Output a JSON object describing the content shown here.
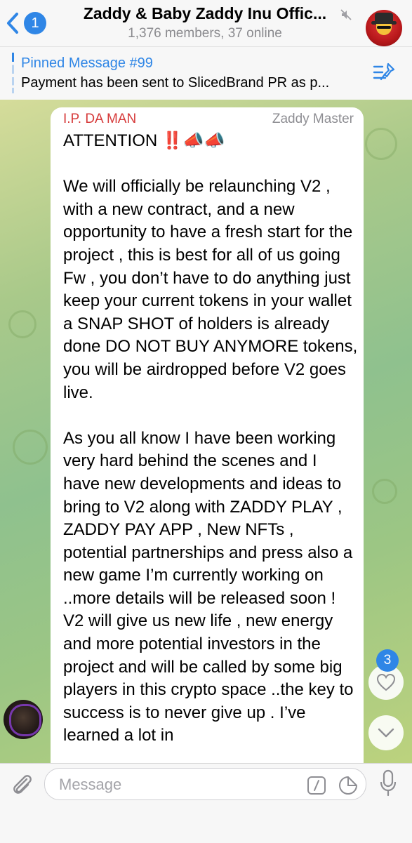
{
  "header": {
    "back_badge": "1",
    "title": "Zaddy & Baby Zaddy Inu Offic...",
    "subtitle": "1,376 members, 37 online",
    "icons": [
      "chevron-left-icon",
      "mute-icon",
      "group-avatar"
    ]
  },
  "pinned": {
    "title": "Pinned Message #99",
    "text": "Payment has been sent to SlicedBrand PR as p...",
    "icon": "pin-list-icon"
  },
  "message": {
    "sender": "I.P. DA MAN",
    "role": "Zaddy Master",
    "text": "ATTENTION ‼️📣📣\n\nWe will officially be relaunching V2 , with a new contract, and a new opportunity to have a fresh start for the project , this is best for all of us going Fw , you don’t have to do anything just keep your current tokens in your wallet a SNAP SHOT of holders is already done DO NOT BUY ANYMORE tokens, you will be airdropped before V2 goes live.\n\nAs you all know I have been working very hard behind the scenes and I have new developments and ideas to bring to V2 along with ZADDY PLAY , ZADDY PAY APP , New NFTs , potential partnerships and press also a new game I’m currently working on ..more details will be released soon ! V2 will give us new life , new energy and more potential investors in the project and will be called by some big players in this crypto space ..the key to success is to never give up . I’ve learned a lot in"
  },
  "reactions": {
    "badge": "3",
    "icon": "heart-icon"
  },
  "composer": {
    "placeholder": "Message",
    "icons": [
      "paperclip-icon",
      "bot-command-icon",
      "sticker-icon",
      "microphone-icon"
    ]
  },
  "colors": {
    "accent": "#2f86e6",
    "sender_name": "#d63a3a",
    "secondary_text": "#8e8e93"
  }
}
